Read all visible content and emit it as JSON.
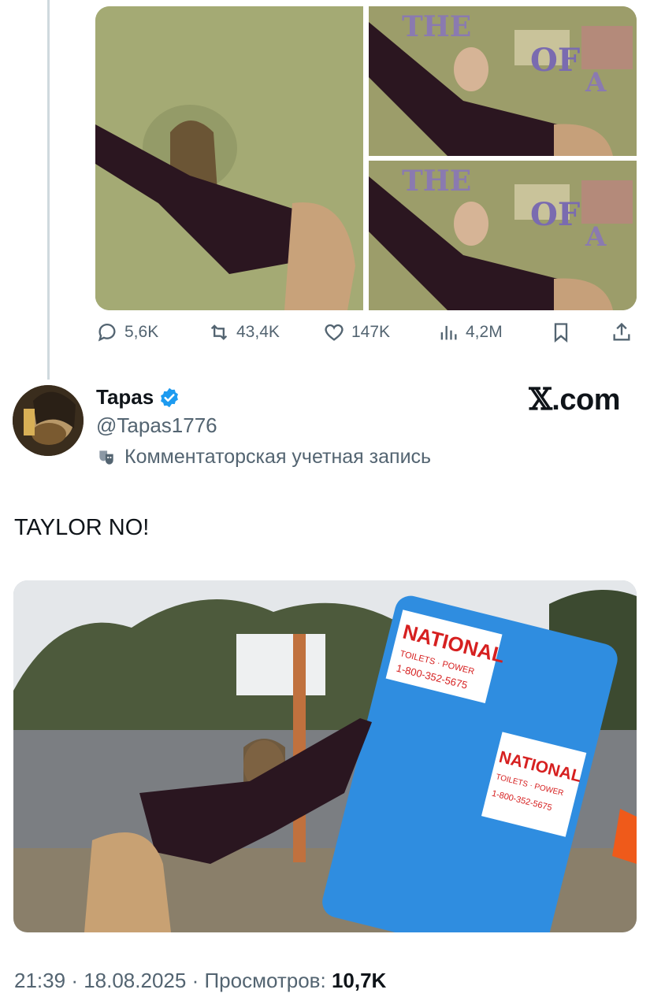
{
  "quoted_tweet": {
    "images": [
      {
        "description": "photo-left"
      },
      {
        "description": "photo-top-right",
        "overlay_text": [
          "THE",
          "OF",
          "A"
        ]
      },
      {
        "description": "photo-bottom-right",
        "overlay_text": [
          "THE",
          "OF",
          "A"
        ]
      }
    ],
    "actions": {
      "replies": "5,6K",
      "reposts": "43,4K",
      "likes": "147K",
      "views": "4,2M"
    }
  },
  "author": {
    "name": "Tapas",
    "handle": "@Tapas1776",
    "account_label": "Комментаторская учетная запись",
    "verified_color": "#1d9bf0"
  },
  "brand": {
    "x": "𝕏",
    "domain": ".com"
  },
  "tweet": {
    "text": "TAYLOR NO!",
    "sign_text": "NATIONAL",
    "sign_sub": "TOILETS · POWER",
    "sign_phone": "1-800-352-5675"
  },
  "meta": {
    "time": "21:39",
    "date": "18.08.2025",
    "views_label": "Просмотров:",
    "views_value": "10,7K"
  }
}
